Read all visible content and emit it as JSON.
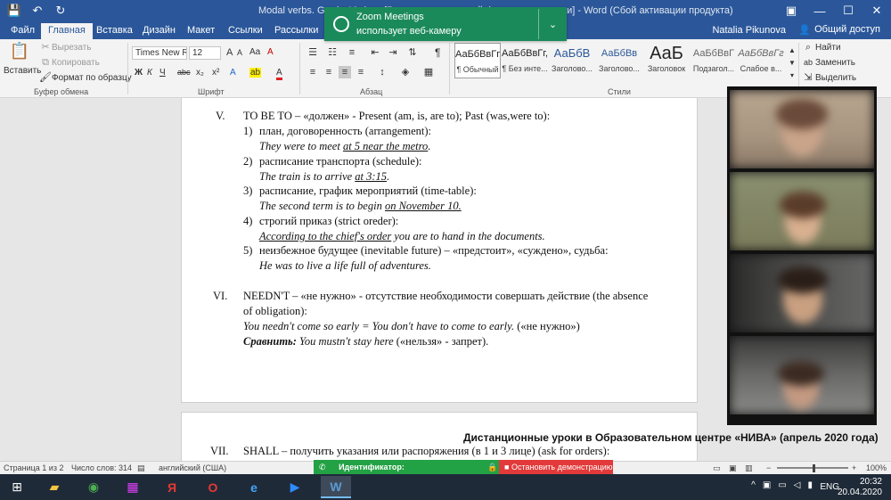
{
  "titlebar": {
    "title": "Modal verbs. Grade 10.docx [Режим ограниченной функциональности] - Word (Сбой активации продукта)",
    "qat": {
      "save_icon": "save-icon",
      "undo_icon": "undo-icon",
      "redo_icon": "redo-icon"
    },
    "controls": {
      "ribbon_options": "▣",
      "minimize": "—",
      "maximize": "☐",
      "close": "✕"
    }
  },
  "zoom_notification": {
    "title": "Zoom Meetings",
    "subtitle": "использует веб-камеру",
    "chevron": "⌄"
  },
  "tabs": {
    "items": [
      {
        "label": "Файл"
      },
      {
        "label": "Главная"
      },
      {
        "label": "Вставка"
      },
      {
        "label": "Дизайн"
      },
      {
        "label": "Макет"
      },
      {
        "label": "Ссылки"
      },
      {
        "label": "Рассылки"
      }
    ],
    "active": "Главная",
    "user": "Natalia Pikunova",
    "share": "Общий доступ"
  },
  "ribbon": {
    "clipboard": {
      "paste": "Вставить",
      "cut": "Вырезать",
      "copy": "Копировать",
      "format_painter": "Формат по образцу",
      "label": "Буфер обмена"
    },
    "font": {
      "family": "Times New R",
      "size": "12",
      "label": "Шрифт",
      "bold": "Ж",
      "italic": "К",
      "underline": "Ч",
      "strike": "abc",
      "subscript": "x₂",
      "superscript": "x²",
      "grow": "A",
      "shrink": "A",
      "case": "Aa",
      "clear": "A",
      "highlight": "ab",
      "color": "A"
    },
    "paragraph": {
      "label": "Абзац",
      "pilcrow": "¶"
    },
    "styles": {
      "label": "Стили",
      "items": [
        {
          "sample": "АаБбВвГг,",
          "name": "¶ Обычный"
        },
        {
          "sample": "АаБбВвГг,",
          "name": "¶ Без инте..."
        },
        {
          "sample": "АаБбВ",
          "name": "Заголово..."
        },
        {
          "sample": "АаБбВв",
          "name": "Заголово..."
        },
        {
          "sample": "АаБ",
          "name": "Заголовок"
        },
        {
          "sample": "АаБбВвГ",
          "name": "Подзагол..."
        },
        {
          "sample": "АаБбВвГг",
          "name": "Слабое в..."
        }
      ]
    },
    "editing": {
      "find": "Найти",
      "replace": "Заменить",
      "select": "Выделить"
    }
  },
  "document": {
    "section5": {
      "num": "V.",
      "head": "TO BE TO – «должен» - Present (am, is, are to); Past (was,were to):",
      "items": [
        {
          "n": "1)",
          "text": "план, договоренность (arrangement):",
          "ex_pre": "They were to meet ",
          "ex_u": "at 5 near the metro",
          "ex_post": "."
        },
        {
          "n": "2)",
          "text": "расписание транспорта (schedule):",
          "ex_pre": "The train is to arrive ",
          "ex_u": "at 3:15",
          "ex_post": "."
        },
        {
          "n": "3)",
          "text": "расписание, график мероприятий (time-table):",
          "ex_pre": "The second term is to begin ",
          "ex_u": "on November 10.",
          "ex_post": ""
        },
        {
          "n": "4)",
          "text": "строгий приказ (strict oreder):",
          "ex_pre": "",
          "ex_u": "According to the chief's order",
          "ex_post": " you are to hand in the documents."
        },
        {
          "n": "5)",
          "text": "неизбежное будущее (inevitable future) – «предстоит», «суждено», судьба:",
          "ex_pre": "He was to live a life full of adventures.",
          "ex_u": "",
          "ex_post": ""
        }
      ]
    },
    "section6": {
      "num": "VI.",
      "head1": "NEEDN'T – «не нужно» - отсутствие необходимости совершать действие (the absence",
      "head2": "of obligation):",
      "ex1_italic": "You needn't come so early = You don't have to come to early.",
      "ex1_plain": " («не нужно»)",
      "ex2_bold": "Сравнить:",
      "ex2_italic": " You mustn't stay here",
      "ex2_plain": " («нельзя» - запрет)."
    },
    "section7": {
      "num": "VII.",
      "head": "SHALL – получить указания или распоряжения (в 1 и 3 лице) (ask for orders):"
    }
  },
  "caption": "Дистанционные уроки в Образовательном центре «НИВА» (апрель 2020 года)",
  "statusbar": {
    "page": "Страница 1 из 2",
    "words": "Число слов: 314",
    "lang": "английский (США)",
    "zoom": "100%"
  },
  "sharebar": {
    "id_label": "Идентификатор:",
    "id_value": "",
    "stop": "Остановить демонстрацию"
  },
  "taskbar": {
    "time": "20:32",
    "date": "20.04.2020",
    "lang": "ENG"
  },
  "colors": {
    "word_blue": "#2b579a",
    "zoom_green": "#1b8a5a",
    "share_green": "#23a145",
    "stop_red": "#e23a3a"
  }
}
